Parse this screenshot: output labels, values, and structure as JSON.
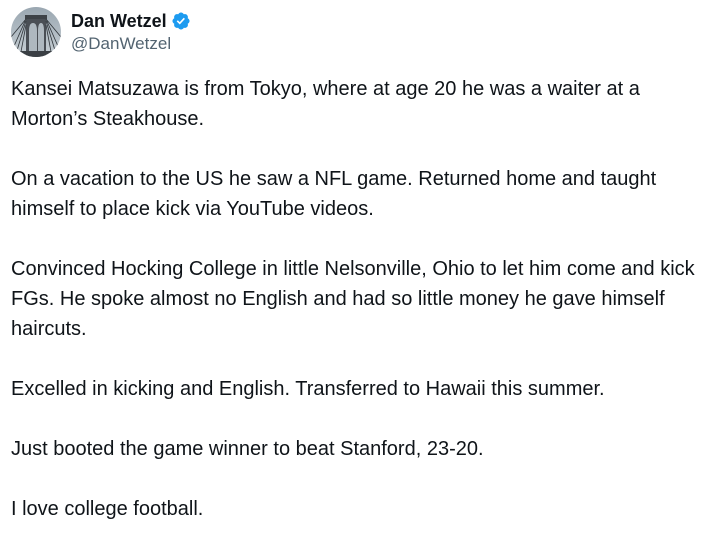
{
  "author": {
    "display_name": "Dan Wetzel",
    "handle": "@DanWetzel",
    "verified_color": "#1d9bf0",
    "avatar_subject": "bridge-photo"
  },
  "tweet": {
    "paragraphs": [
      "Kansei Matsuzawa is from Tokyo, where at age 20 he was a waiter at a Morton’s Steakhouse.",
      "On a vacation to the US he saw a NFL game. Returned home and taught himself to place kick via YouTube videos.",
      "Convinced Hocking College in little Nelsonville, Ohio to let him come and kick FGs. He spoke almost no English and had so little money he gave himself haircuts.",
      "Excelled in kicking and English. Transferred to Hawaii this summer.",
      "Just booted the game winner to beat Stanford, 23-20.",
      "I love college football."
    ]
  }
}
